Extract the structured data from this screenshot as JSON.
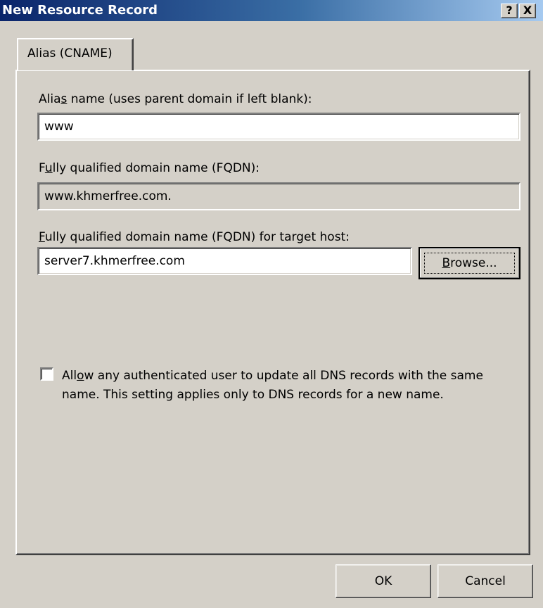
{
  "window": {
    "title": "New Resource Record",
    "help_glyph": "?",
    "close_glyph": "X"
  },
  "tab": {
    "label": "Alias (CNAME)"
  },
  "alias": {
    "label_pre": "Alia",
    "label_accel": "s",
    "label_post": " name (uses parent domain if left blank):",
    "value": "www"
  },
  "fqdn": {
    "label_pre": "F",
    "label_accel": "u",
    "label_post": "lly qualified domain name (FQDN):",
    "value": "www.khmerfree.com."
  },
  "target": {
    "label_pre": "",
    "label_accel": "F",
    "label_post": "ully qualified domain name (FQDN) for target host:",
    "value": "server7.khmerfree.com",
    "browse_accel": "B",
    "browse_rest": "rowse..."
  },
  "allow": {
    "line1_pre": "All",
    "line1_accel": "o",
    "line1_post": "w any authenticated user to update all DNS records with the same",
    "line2": "name. This setting applies only to DNS records for a new name.",
    "checked": false
  },
  "footer": {
    "ok_label": "OK",
    "cancel_label": "Cancel"
  }
}
